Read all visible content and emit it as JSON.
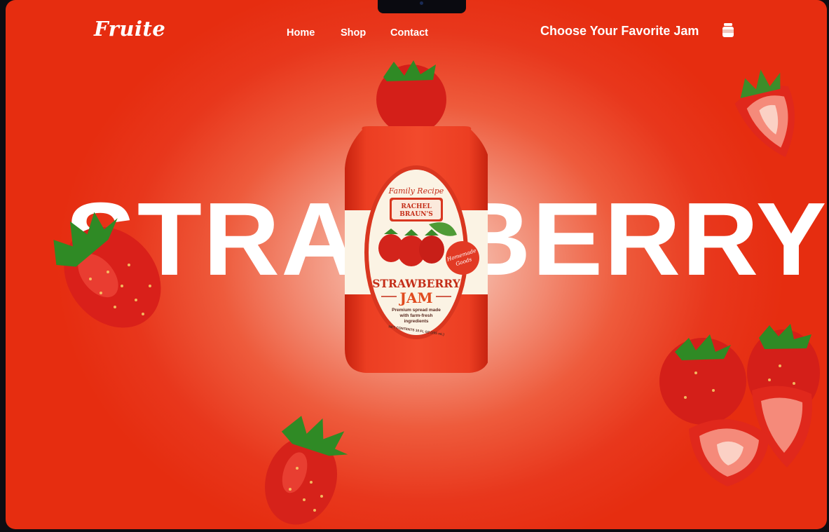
{
  "brand": {
    "logo_text": "Fruite"
  },
  "nav": {
    "items": [
      {
        "label": "Home"
      },
      {
        "label": "Shop"
      },
      {
        "label": "Contact"
      }
    ]
  },
  "header": {
    "tagline": "Choose Your Favorite Jam",
    "cart_icon": "jar-cart-icon"
  },
  "hero": {
    "headline": "STRAWBERRY",
    "product": {
      "label_script_top": "Family Recipe",
      "brand_name_line1": "RACHEL",
      "brand_name_line2": "BRAUN'S",
      "seal_line1": "Homemade",
      "seal_line2": "Goods",
      "product_name": "STRAWBERRY",
      "product_type": "JAM",
      "description_line1": "Premium spread made",
      "description_line2": "with farm-fresh",
      "description_line3": "ingredients",
      "net_contents": "NET CONTENTS 10 FL OZ (295 mL)"
    }
  },
  "colors": {
    "background_red": "#e8371c",
    "jar_red": "#e8361f",
    "label_cream": "#fbf3e4",
    "text_red": "#d5321f",
    "white": "#ffffff"
  }
}
